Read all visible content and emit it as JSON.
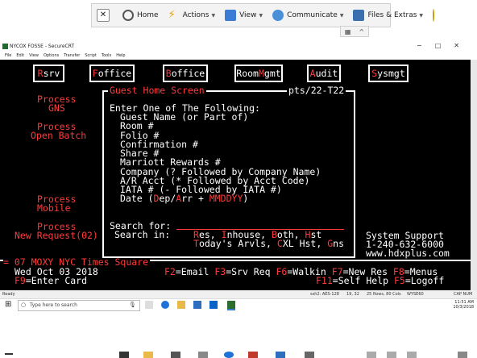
{
  "toolbar": {
    "home": "Home",
    "actions": "Actions",
    "view": "View",
    "communicate": "Communicate",
    "files": "Files & Extras"
  },
  "window": {
    "title": "NYCOX FOSSE - SecureCRT",
    "menu": [
      "File",
      "Edit",
      "View",
      "Options",
      "Transfer",
      "Script",
      "Tools",
      "Help"
    ]
  },
  "terminal": {
    "buttons": [
      {
        "hot": "R",
        "rest": "srv"
      },
      {
        "hot": "F",
        "rest": "office"
      },
      {
        "hot": "B",
        "rest": "office"
      },
      {
        "pre": "Room",
        "hot": "M",
        "rest": "gmt"
      },
      {
        "hot": "A",
        "rest": "udit"
      },
      {
        "hot": "S",
        "rest": "ysmgt"
      }
    ],
    "left_menu": {
      "process_gns_1": "Process",
      "process_gns_2": "GNS",
      "open_batch_1": "Process",
      "open_batch_2": "Open Batch",
      "mobile_1": "Process",
      "mobile_2": "Mobile",
      "new_request_1": "Process",
      "new_request_2": "New Request(02)"
    },
    "panel": {
      "title": "Guest Home Screen",
      "terminal_id": "pts/22-T22",
      "prompt": "Enter One of The Following:",
      "options": [
        "Guest Name (or Part of)",
        "Room #",
        "Folio #",
        "Confirmation #",
        "Share #",
        "Marriott Rewards #",
        "Company (? Followed by Company Name)",
        "A/R Acct (* Followed by Acct Code)",
        "IATA # (- Followed by IATA #)"
      ],
      "date_label": "Date (",
      "date_dep": "D",
      "date_ep": "ep/",
      "date_arr": "A",
      "date_rr": "rr + ",
      "date_fmt": "MMDDYY",
      "date_close": ")",
      "search_for": "Search for:",
      "search_in": "Search in:",
      "search_in_line1": {
        "R": "R",
        "es": "es, ",
        "I": "I",
        "nhouse": "nhouse, ",
        "B": "B",
        "oth": "oth, ",
        "H": "H",
        "st": "st"
      },
      "search_in_line2": {
        "T": "T",
        "odays": "oday's Arvls, ",
        "C": "C",
        "XL": "XL Hst, ",
        "G": "G",
        "ns": "ns"
      }
    },
    "support": {
      "title": "System Support",
      "phone": "1-240-632-6000",
      "url": "www.hdxplus.com"
    },
    "footer": {
      "property": "= 07 MOXY NYC Times Square",
      "date": "Wed Oct 03 2018",
      "f9": "F9",
      "f9_label": "=Enter Card",
      "keys_row1": [
        {
          "key": "F2",
          "label": "=Email "
        },
        {
          "key": "F3",
          "label": "=Srv Req "
        },
        {
          "key": "F6",
          "label": "=Walkin "
        },
        {
          "key": "F7",
          "label": "=New Res "
        },
        {
          "key": "F8",
          "label": "=Menus"
        }
      ],
      "keys_row2": [
        {
          "key": "F11",
          "label": "=Self Help "
        },
        {
          "key": "F5",
          "label": "=Logoff"
        }
      ]
    }
  },
  "statusbar": {
    "ready": "Ready",
    "conn": "ssh2: AES-128",
    "pos": "19, 32",
    "size": "25 Rows, 80 Cols",
    "term": "WYSE60",
    "caps": "CAP NUM"
  },
  "taskbar": {
    "search_placeholder": "Type here to search",
    "time": "11:51 AM",
    "date": "10/3/2018"
  },
  "colors": {
    "terminal_bg": "#000000",
    "hotkey": "#ff3b3b",
    "text": "#ffffff"
  }
}
